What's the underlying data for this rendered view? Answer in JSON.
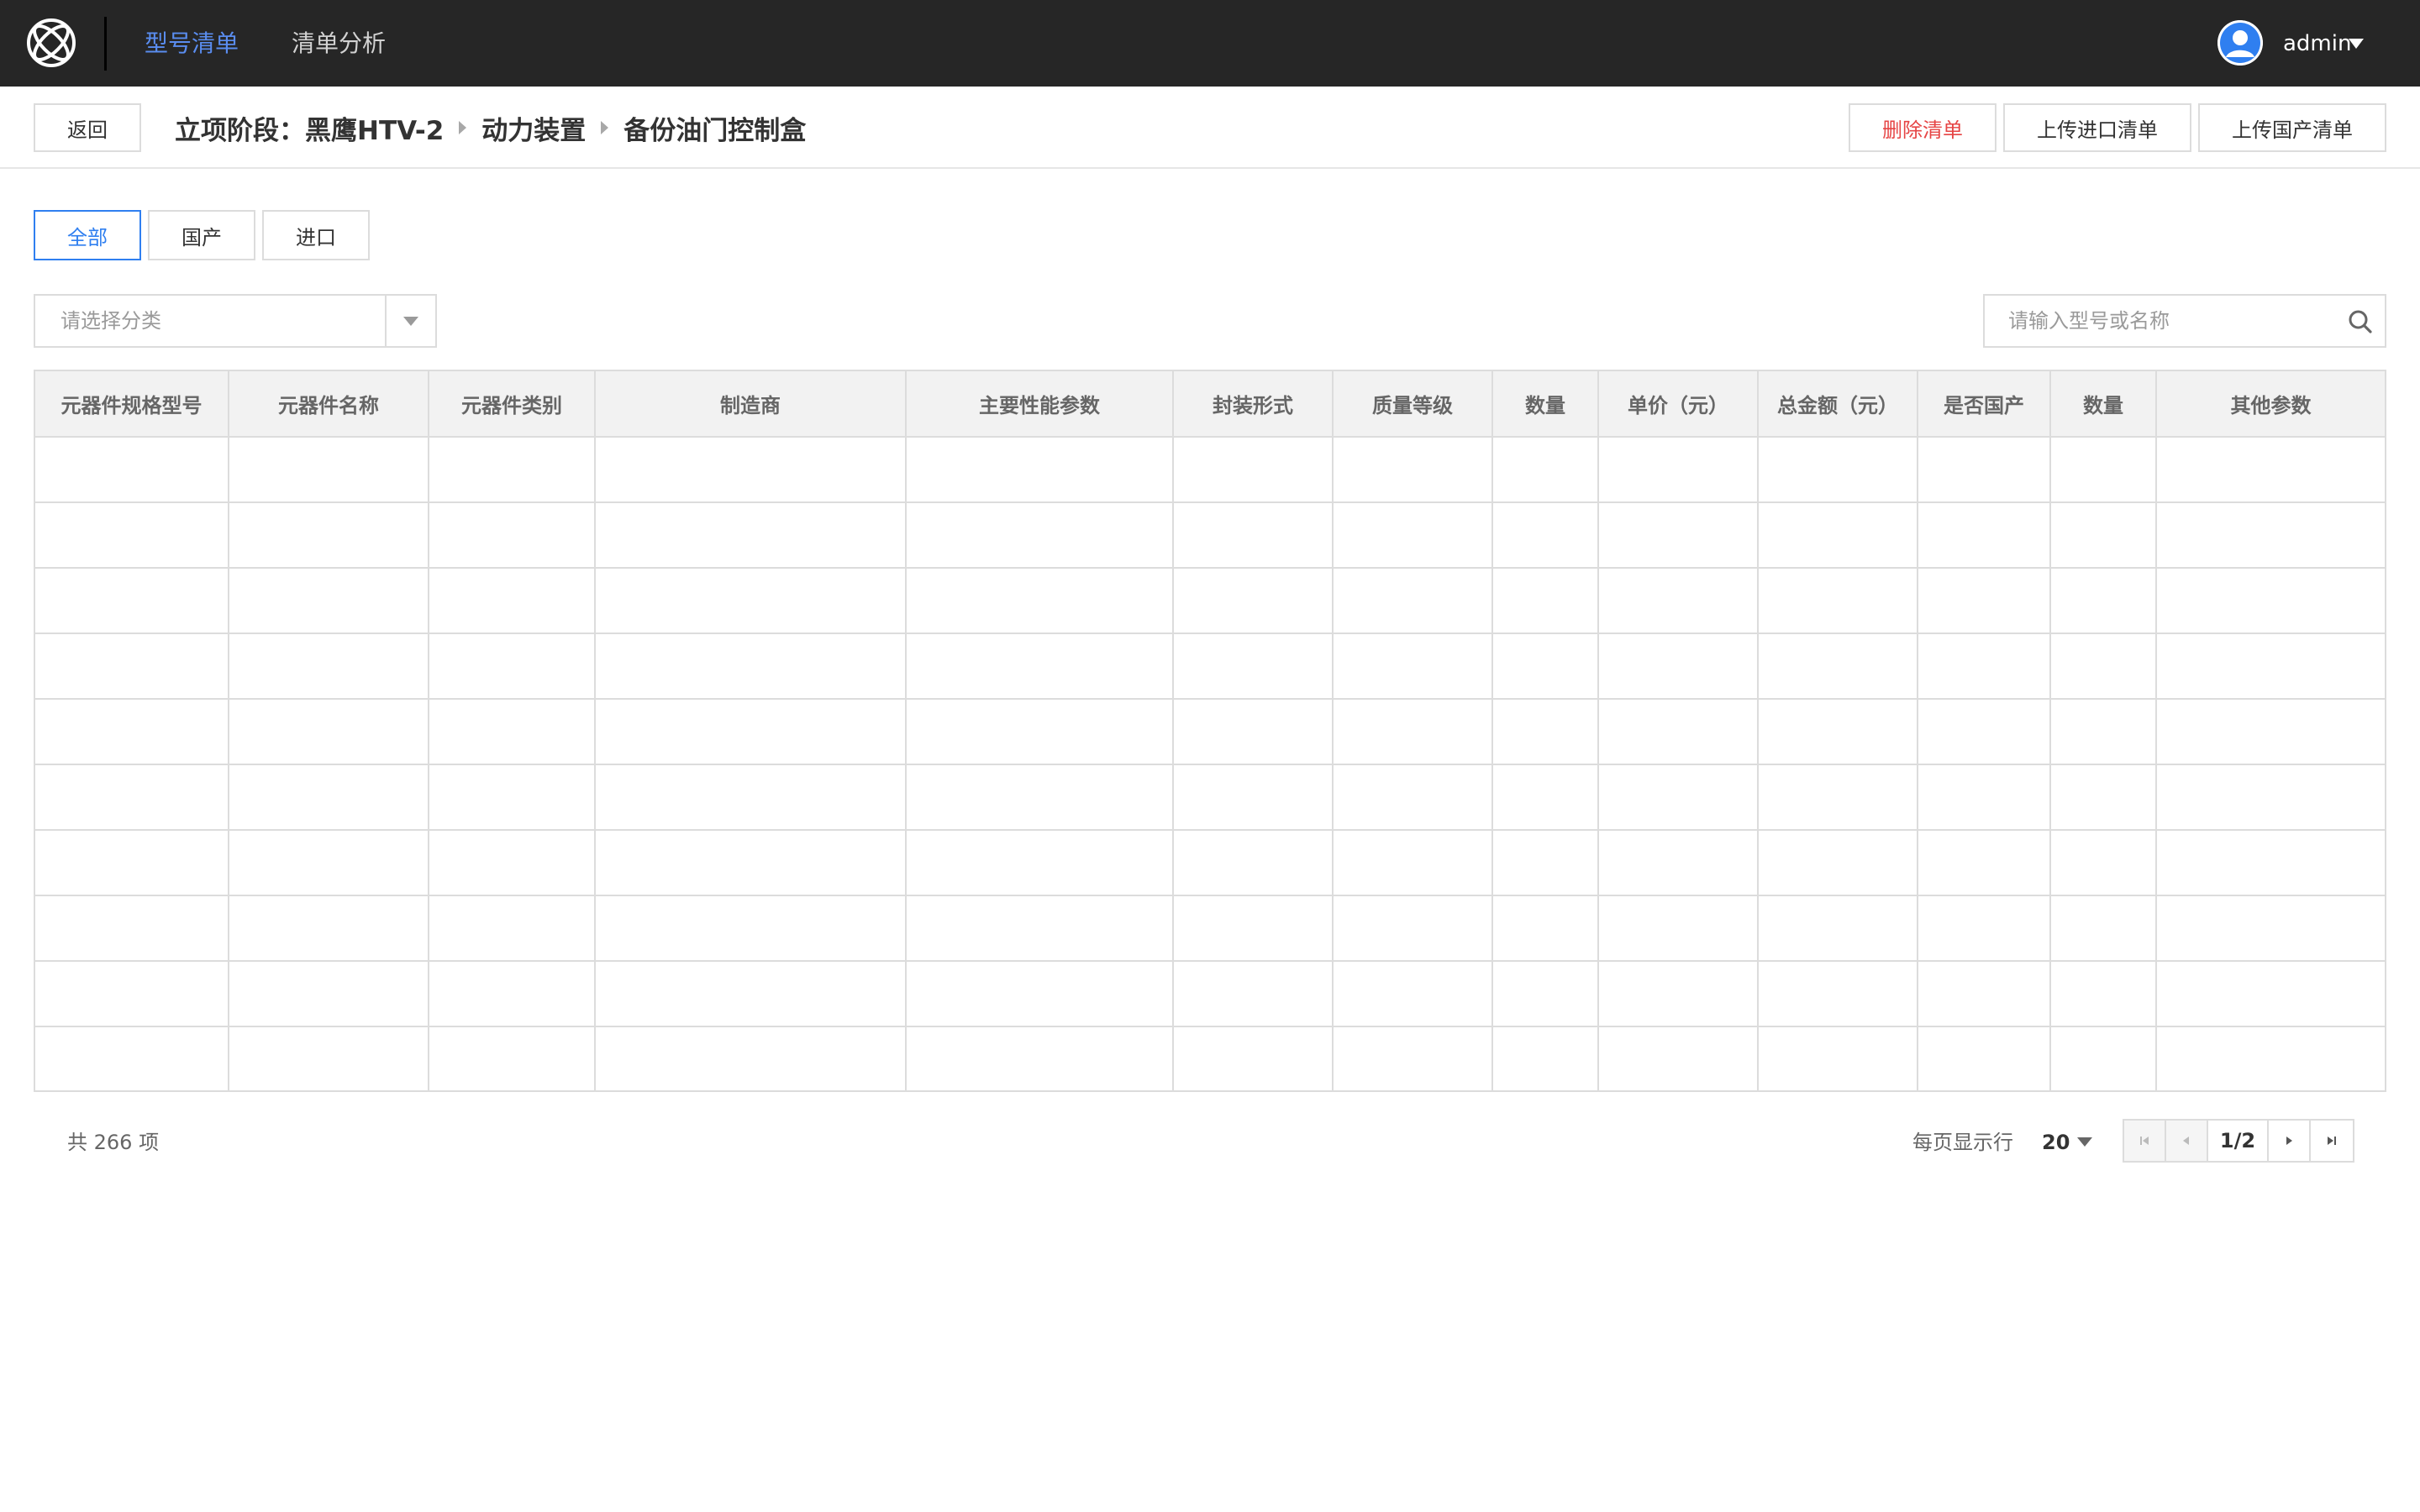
{
  "nav": {
    "items": [
      {
        "label": "型号清单",
        "active": true
      },
      {
        "label": "清单分析",
        "active": false
      }
    ],
    "user": {
      "name": "admin",
      "avatar_icon": "user-avatar-icon"
    },
    "accent_color": "#5a8df0"
  },
  "header": {
    "back_label": "返回",
    "breadcrumb": [
      "立项阶段：黑鹰HTV-2",
      "动力装置",
      "备份油门控制盒"
    ],
    "delete_label": "删除清单",
    "upload_import_label": "上传进口清单",
    "upload_domestic_label": "上传国产清单"
  },
  "filters": {
    "tabs": [
      {
        "label": "全部",
        "active": true
      },
      {
        "label": "国产",
        "active": false
      },
      {
        "label": "进口",
        "active": false
      }
    ],
    "category_placeholder": "请选择分类",
    "search_placeholder": "请输入型号或名称"
  },
  "table": {
    "columns": [
      "元器件规格型号",
      "元器件名称",
      "元器件类别",
      "制造商",
      "主要性能参数",
      "封装形式",
      "质量等级",
      "数量",
      "单价（元）",
      "总金额（元）",
      "是否国产",
      "数量",
      "其他参数"
    ],
    "row_count": 10
  },
  "pagination": {
    "total_text": "共 266 项",
    "per_page_label": "每页显示行",
    "per_page_value": "20",
    "page_indicator": "1/2"
  }
}
